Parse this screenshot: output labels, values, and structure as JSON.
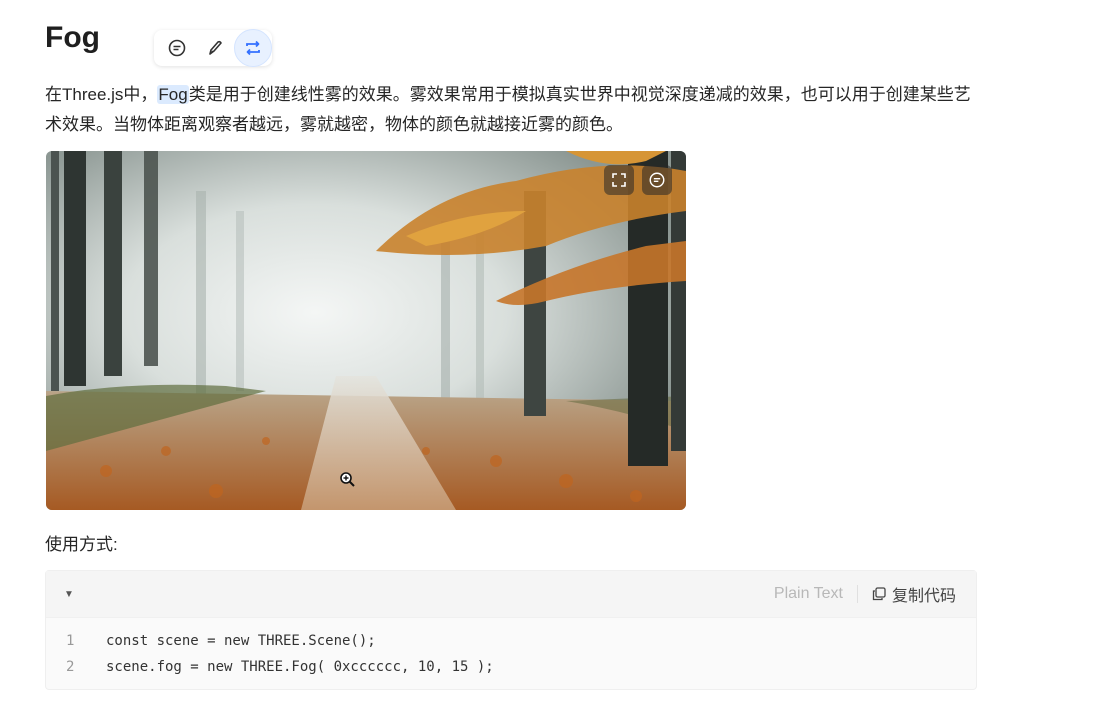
{
  "heading": "Fog",
  "toolbar": {
    "icons": [
      "comment-icon",
      "pen-icon",
      "repeat-icon"
    ]
  },
  "paragraph": {
    "pre": "在Three.js中，",
    "highlight": "Fog",
    "post": "类是用于创建线性雾的效果。雾效果常用于模拟真实世界中视觉深度递减的效果，也可以用于创建某些艺术效果。当物体距离观察者越远，雾就越密，物体的颜色就越接近雾的颜色。"
  },
  "image": {
    "alt": "foggy autumn forest path",
    "buttons": [
      "expand-icon",
      "comment-icon"
    ]
  },
  "usage_label": "使用方式:",
  "code": {
    "language": "Plain Text",
    "copy_label": "复制代码",
    "lines": [
      {
        "no": "1",
        "text": "const scene = new THREE.Scene();"
      },
      {
        "no": "2",
        "text": "scene.fog = new THREE.Fog( 0xcccccc, 10, 15 );"
      }
    ]
  },
  "colors": {
    "accent": "#3370ff",
    "highlight_bg": "#dbeafe",
    "code_bg": "#fafafa"
  }
}
